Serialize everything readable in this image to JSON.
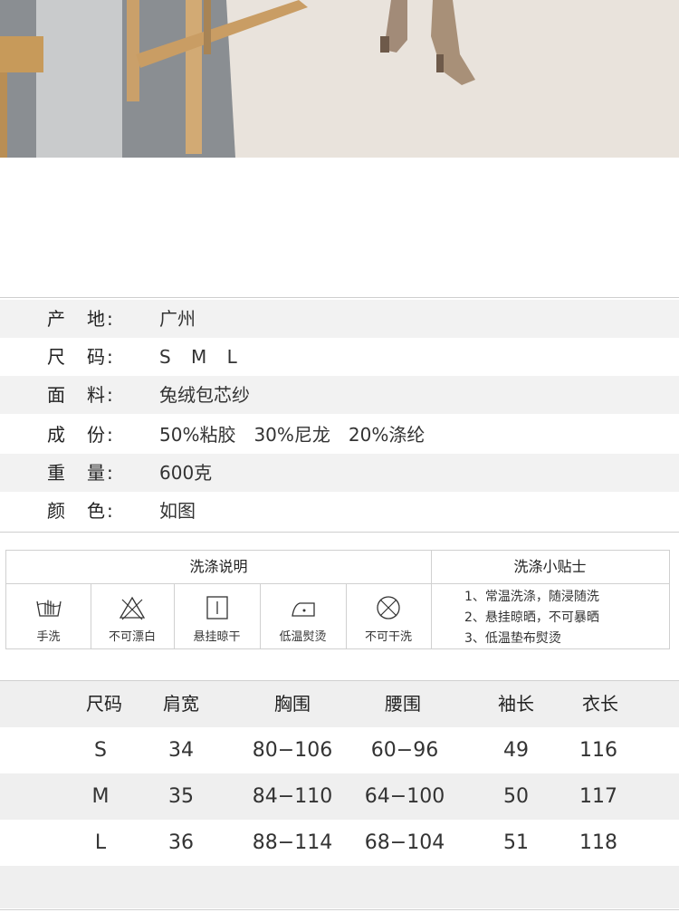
{
  "photo": {
    "alt": ""
  },
  "info": {
    "rows": [
      {
        "key": "产　地:",
        "value": "广州"
      },
      {
        "key": "尺　码:",
        "value": "S M L"
      },
      {
        "key": "面　料:",
        "value": "兔绒包芯纱"
      },
      {
        "key": "成　份:",
        "value": "50%粘胶　30%尼龙　20%涤纶"
      },
      {
        "key": "重　量:",
        "value": "600克"
      },
      {
        "key": "颜　色:",
        "value": "如图"
      }
    ]
  },
  "wash": {
    "title_left": "洗涤说明",
    "title_right": "洗涤小贴士",
    "symbols": [
      {
        "label": "手洗",
        "icon": "hand-wash-icon"
      },
      {
        "label": "不可漂白",
        "icon": "no-bleach-icon"
      },
      {
        "label": "悬挂晾干",
        "icon": "line-dry-icon"
      },
      {
        "label": "低温熨烫",
        "icon": "low-iron-icon"
      },
      {
        "label": "不可干洗",
        "icon": "no-dry-clean-icon"
      }
    ],
    "tips": [
      "1、常温洗涤，随浸随洗",
      "2、悬挂晾晒，不可暴晒",
      "3、低温垫布熨烫"
    ]
  },
  "size_chart": {
    "headers": [
      "尺码",
      "肩宽",
      "胸围",
      "腰围",
      "袖长",
      "衣长"
    ],
    "rows": [
      [
        "S",
        "34",
        "80−106",
        "60−96",
        "49",
        "116"
      ],
      [
        "M",
        "35",
        "84−110",
        "64−100",
        "50",
        "117"
      ],
      [
        "L",
        "36",
        "88−114",
        "68−104",
        "51",
        "118"
      ]
    ]
  }
}
